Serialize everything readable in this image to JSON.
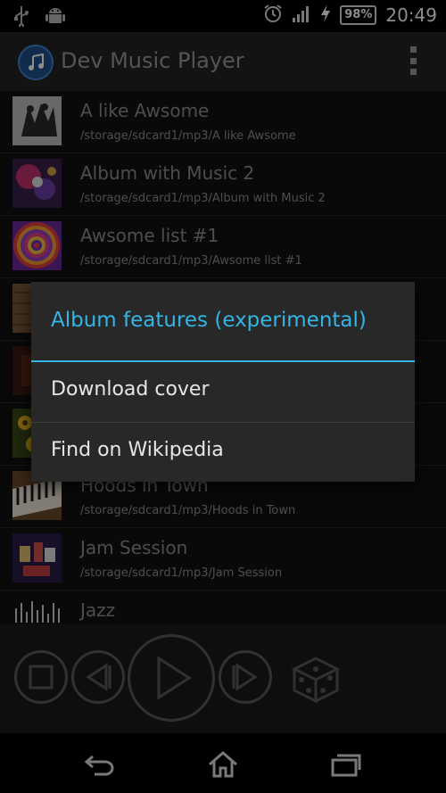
{
  "status_bar": {
    "icons": [
      "usb-icon",
      "android-icon",
      "alarm-icon",
      "signal-icon",
      "charging-icon"
    ],
    "battery": "98%",
    "time": "20:49"
  },
  "app_bar": {
    "title": "Dev Music Player",
    "logo_icon": "music-note-icon",
    "menu_icon": "overflow-menu-icon"
  },
  "tracks": [
    {
      "title": "A like Awsome",
      "path": "/storage/sdcard1/mp3/A like Awsome"
    },
    {
      "title": "Album with Music 2",
      "path": "/storage/sdcard1/mp3/Album with Music 2"
    },
    {
      "title": "Awsome list #1",
      "path": "/storage/sdcard1/mp3/Awsome list #1"
    },
    {
      "title": "",
      "path": ""
    },
    {
      "title": "",
      "path": ""
    },
    {
      "title": "",
      "path": ""
    },
    {
      "title": "Hoods in Town",
      "path": "/storage/sdcard1/mp3/Hoods in Town"
    },
    {
      "title": "Jam Session",
      "path": "/storage/sdcard1/mp3/Jam Session"
    },
    {
      "title": "Jazz",
      "path": ""
    }
  ],
  "dialog": {
    "title": "Album features (experimental)",
    "items": [
      "Download cover",
      "Find on Wikipedia"
    ]
  },
  "player": {
    "buttons": [
      "stop-icon",
      "previous-icon",
      "play-icon",
      "next-icon",
      "shuffle-dice-icon"
    ]
  },
  "nav_bar": {
    "buttons": [
      "back-icon",
      "home-icon",
      "recent-apps-icon"
    ]
  },
  "colors": {
    "accent": "#33b5e5",
    "dialog_bg": "#282828",
    "list_bg": "#121212"
  }
}
